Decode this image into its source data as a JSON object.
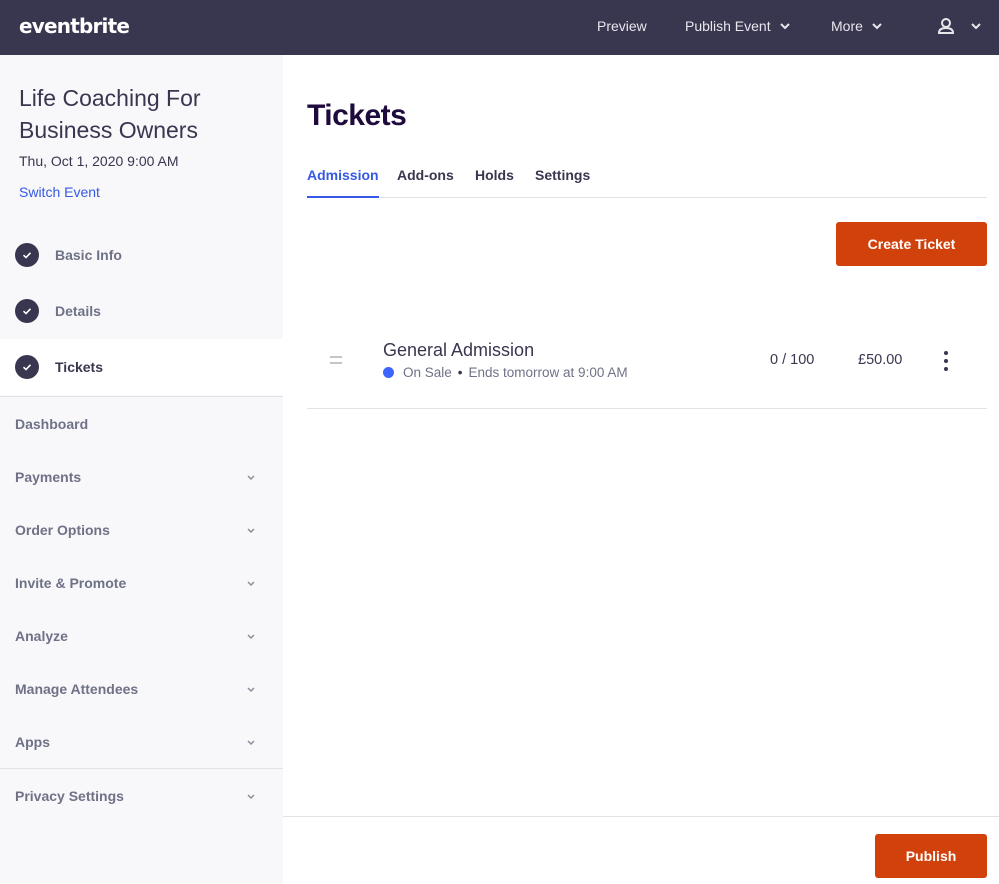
{
  "topbar": {
    "logo": "eventbrite",
    "nav": {
      "preview": "Preview",
      "publish_event": "Publish Event",
      "more": "More"
    },
    "account_icon": "user-icon"
  },
  "sidebar": {
    "event_title": "Life Coaching For Business Owners",
    "event_date": "Thu, Oct 1, 2020 9:00 AM",
    "switch_event": "Switch Event",
    "steps": [
      {
        "label": "Basic Info",
        "completed": true
      },
      {
        "label": "Details",
        "completed": true
      },
      {
        "label": "Tickets",
        "completed": true,
        "active": true
      }
    ],
    "dashboard": "Dashboard",
    "menu": [
      {
        "label": "Payments"
      },
      {
        "label": "Order Options"
      },
      {
        "label": "Invite & Promote"
      },
      {
        "label": "Analyze"
      },
      {
        "label": "Manage Attendees"
      },
      {
        "label": "Apps"
      }
    ],
    "privacy": "Privacy Settings"
  },
  "main": {
    "title": "Tickets",
    "tabs": [
      {
        "label": "Admission",
        "active": true
      },
      {
        "label": "Add-ons"
      },
      {
        "label": "Holds"
      },
      {
        "label": "Settings"
      }
    ],
    "create_ticket": "Create Ticket",
    "tickets": [
      {
        "name": "General Admission",
        "status": "On Sale",
        "status_color": "#3d64ff",
        "ends": "Ends tomorrow at 9:00 AM",
        "quantity": "0 / 100",
        "price": "£50.00"
      }
    ],
    "publish": "Publish"
  },
  "colors": {
    "topbar": "#39364f",
    "accent_orange": "#d1410c",
    "link_blue": "#3659e3"
  }
}
